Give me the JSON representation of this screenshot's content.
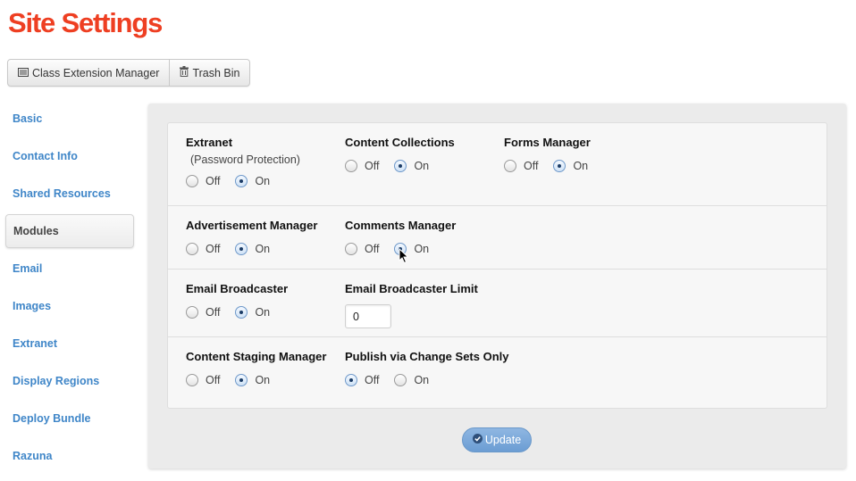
{
  "page": {
    "title": "Site Settings"
  },
  "toolbar": {
    "class_extension_label": "Class Extension Manager",
    "trash_label": "Trash Bin"
  },
  "sidebar": {
    "items": [
      {
        "label": "Basic"
      },
      {
        "label": "Contact Info"
      },
      {
        "label": "Shared Resources"
      },
      {
        "label": "Modules",
        "active": true
      },
      {
        "label": "Email"
      },
      {
        "label": "Images"
      },
      {
        "label": "Extranet"
      },
      {
        "label": "Display Regions"
      },
      {
        "label": "Deploy Bundle"
      },
      {
        "label": "Razuna"
      }
    ]
  },
  "modules": {
    "extranet": {
      "label": "Extranet",
      "sublabel": "(Password Protection)",
      "off": "Off",
      "on": "On",
      "value": "On"
    },
    "content_collections": {
      "label": "Content Collections",
      "off": "Off",
      "on": "On",
      "value": "On"
    },
    "forms_manager": {
      "label": "Forms Manager",
      "off": "Off",
      "on": "On",
      "value": "On"
    },
    "advertisement_manager": {
      "label": "Advertisement Manager",
      "off": "Off",
      "on": "On",
      "value": "On"
    },
    "comments_manager": {
      "label": "Comments Manager",
      "off": "Off",
      "on": "On",
      "value": "On"
    },
    "email_broadcaster": {
      "label": "Email Broadcaster",
      "off": "Off",
      "on": "On",
      "value": "On"
    },
    "email_broadcaster_limit": {
      "label": "Email Broadcaster Limit",
      "value": "0"
    },
    "content_staging_manager": {
      "label": "Content Staging Manager",
      "off": "Off",
      "on": "On",
      "value": "On"
    },
    "publish_via_change_sets": {
      "label": "Publish via Change Sets Only",
      "off": "Off",
      "on": "On",
      "value": "Off"
    }
  },
  "actions": {
    "update_label": "Update"
  },
  "colors": {
    "title": "#ee3f22",
    "link": "#3f86c8",
    "primary_button": "#7aa8da"
  }
}
